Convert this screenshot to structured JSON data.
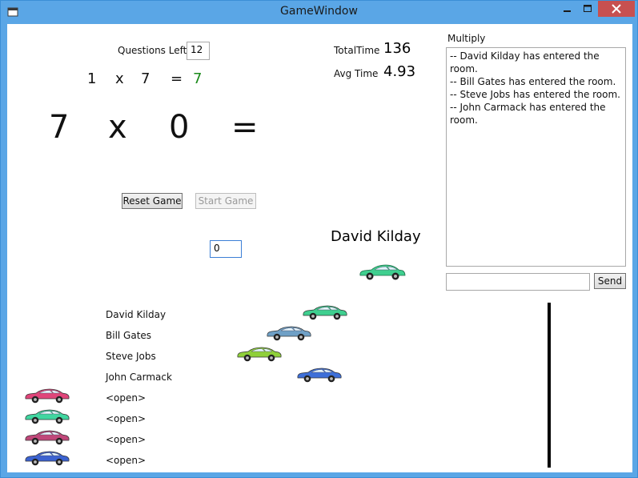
{
  "window": {
    "title": "GameWindow"
  },
  "stats": {
    "questions_left_label": "Questions Left",
    "questions_left_value": "12",
    "total_time_label": "TotalTime",
    "total_time_value": "136",
    "avg_time_label": "Avg Time",
    "avg_time_value": "4.93"
  },
  "previous_question": {
    "a": "1",
    "op": "x",
    "b": "7",
    "eq": "=",
    "answer": "7"
  },
  "current_question": {
    "a": "7",
    "op": "x",
    "b": "0",
    "eq": "="
  },
  "buttons": {
    "reset": "Reset Game",
    "start": "Start Game",
    "send": "Send"
  },
  "answer_input": {
    "value": "0"
  },
  "current_player": "David Kilday",
  "chat": {
    "title": "Multiply",
    "messages": [
      "-- David Kilday has entered the room.",
      "-- Bill Gates has entered the room.",
      "-- Steve Jobs has entered the room.",
      "-- John Carmack has entered the room."
    ],
    "input_value": ""
  },
  "race": {
    "players": [
      {
        "name": "David Kilday",
        "car_color": "#3fcf8f",
        "progress": 0.55
      },
      {
        "name": "Bill Gates",
        "car_color": "#6fa0c6",
        "progress": 0.48
      },
      {
        "name": "Steve Jobs",
        "car_color": "#8fd03a",
        "progress": 0.42
      },
      {
        "name": "John Carmack",
        "car_color": "#3d6fd8",
        "progress": 0.54
      },
      {
        "name": "<open>",
        "car_color": "#e0457a",
        "progress": 0.0
      },
      {
        "name": "<open>",
        "car_color": "#40d6a0",
        "progress": 0.0
      },
      {
        "name": "<open>",
        "car_color": "#c0477a",
        "progress": 0.0
      },
      {
        "name": "<open>",
        "car_color": "#3b62d0",
        "progress": 0.0
      }
    ]
  },
  "colors": {
    "correct_answer": "#1a8a1a",
    "title_bar": "#5aa6e6"
  }
}
